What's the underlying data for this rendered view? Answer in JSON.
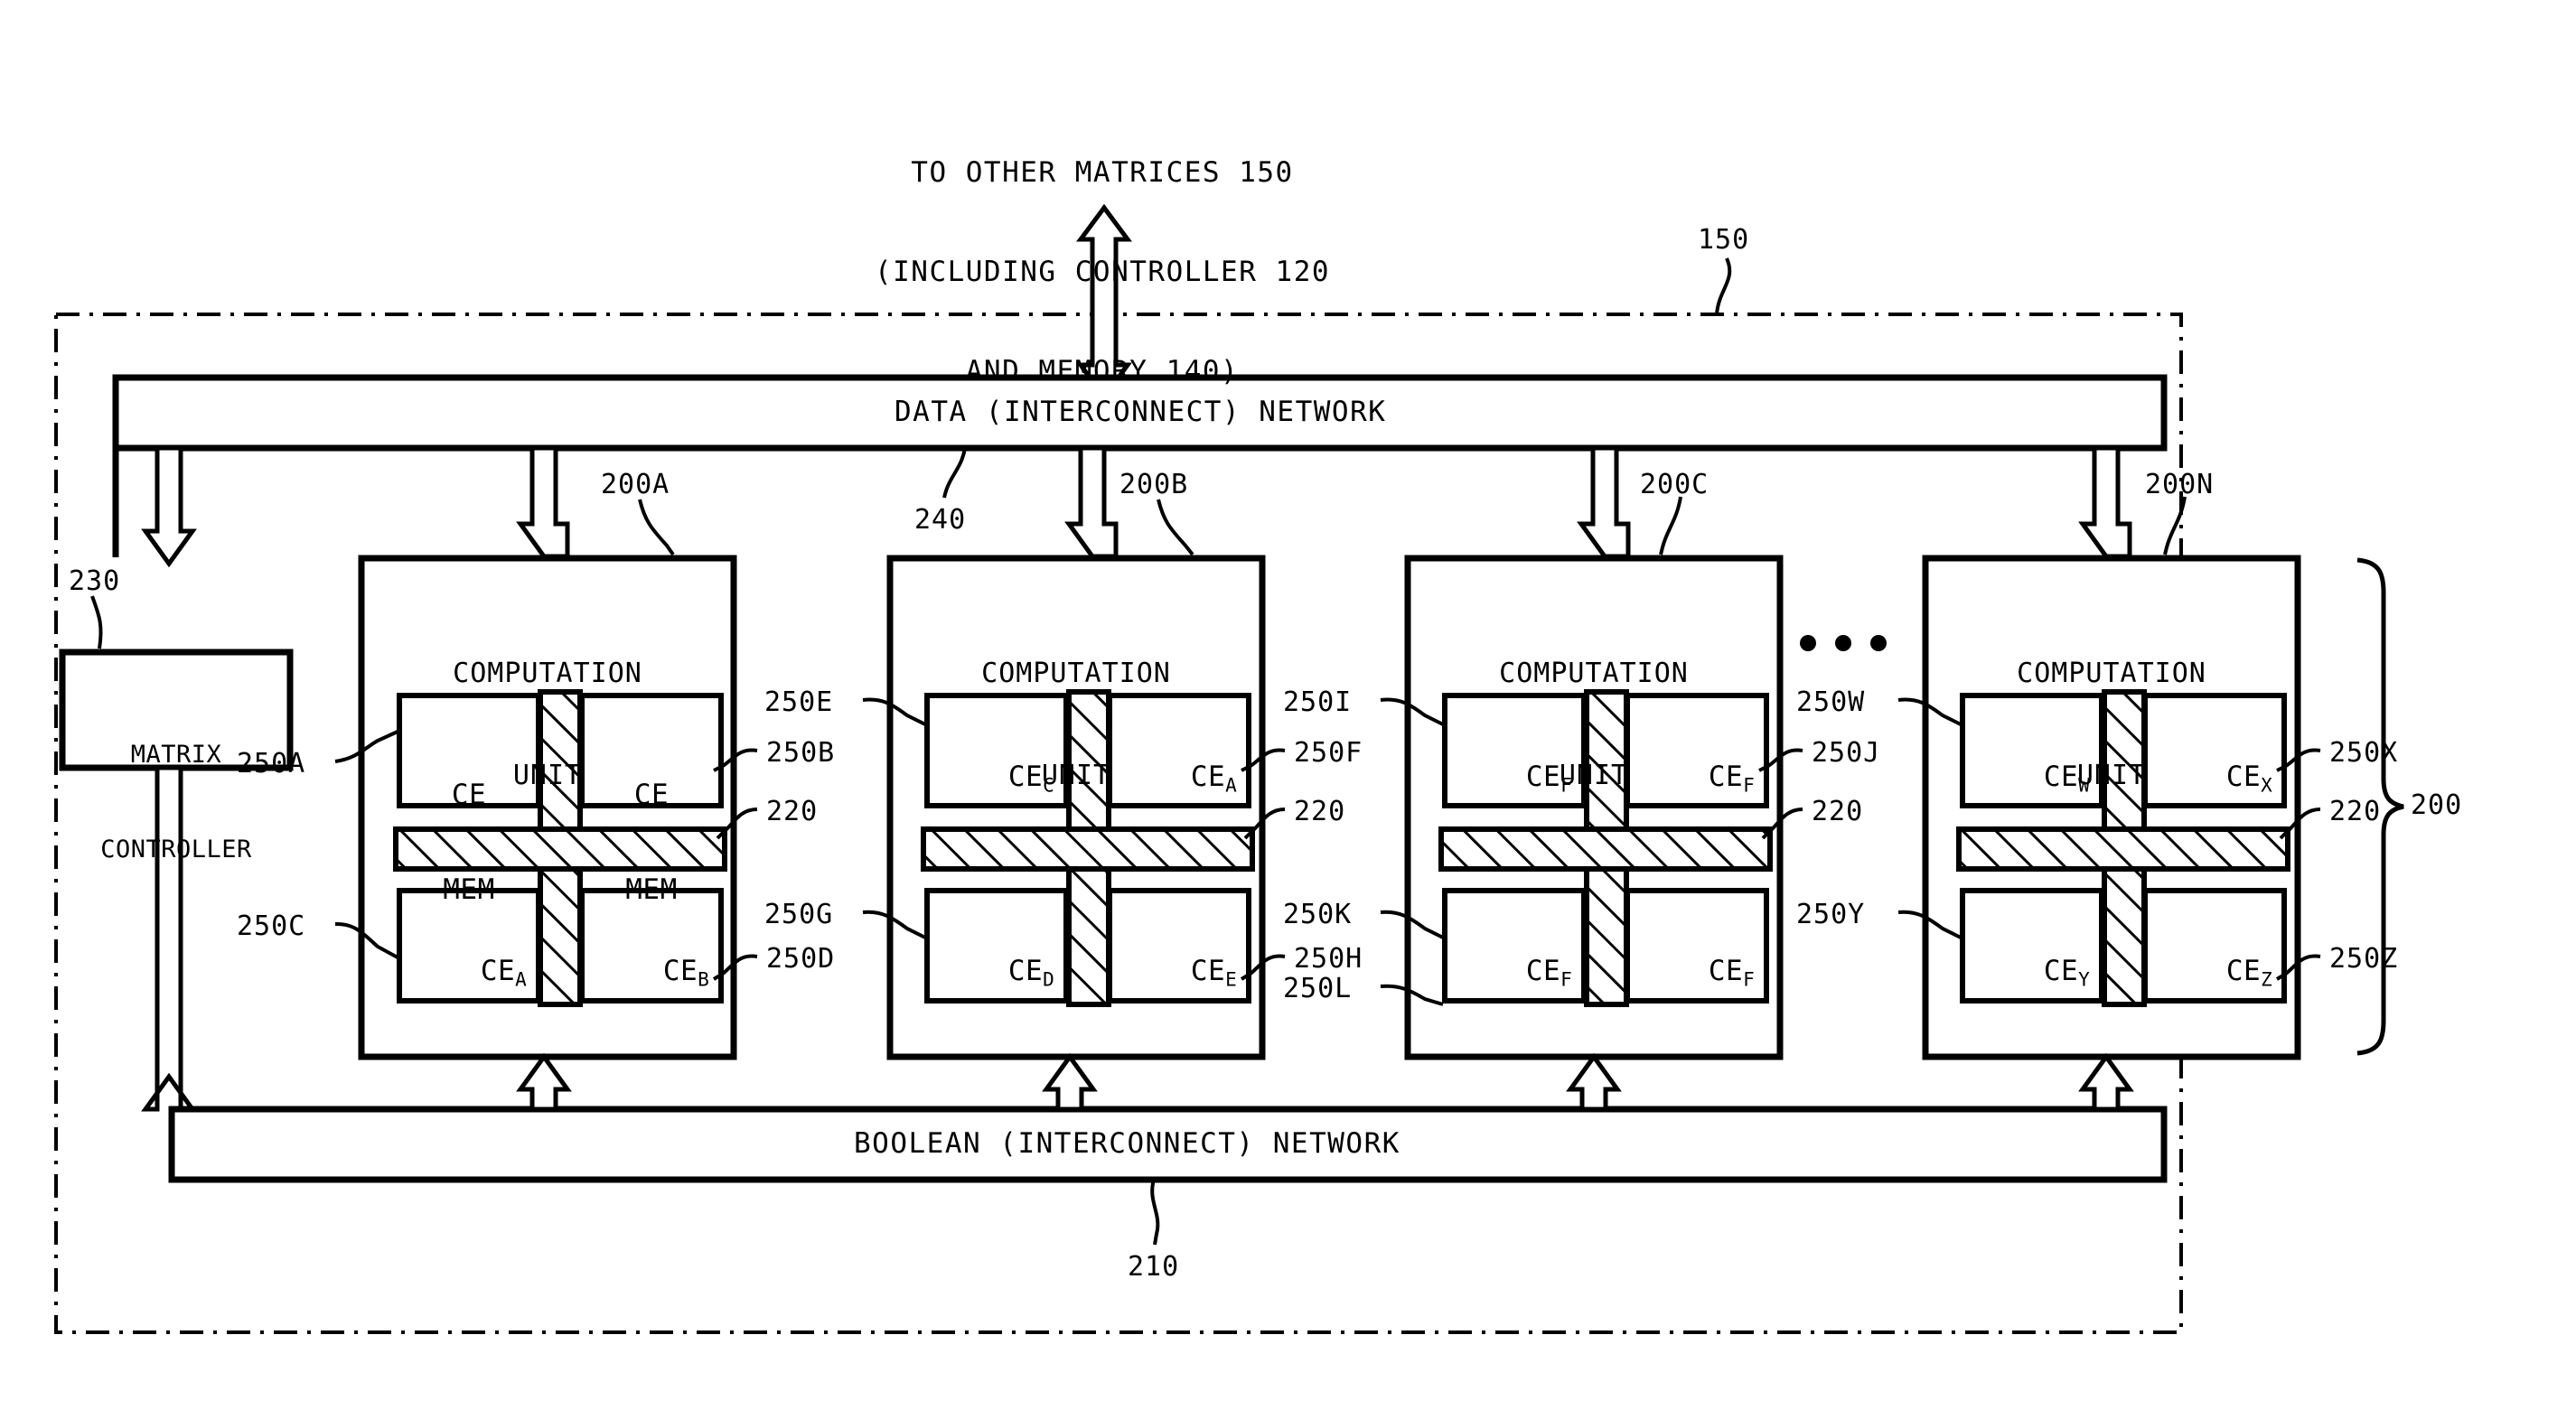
{
  "figure": {
    "header_note": "TO OTHER MATRICES 150\n(INCLUDING CONTROLLER 120\nAND MEMORY 140)",
    "header_line_1": "TO OTHER MATRICES 150",
    "header_line_2": "(INCLUDING CONTROLLER 120",
    "header_line_3": "AND MEMORY 140)",
    "outer_ref": "150",
    "group_brace_ref": "200"
  },
  "networks": {
    "data": {
      "label": "DATA (INTERCONNECT) NETWORK",
      "ref": "240"
    },
    "boolean": {
      "label": "BOOLEAN (INTERCONNECT) NETWORK",
      "ref": "210"
    }
  },
  "controller": {
    "line1": "MATRIX",
    "line2": "CONTROLLER",
    "ref": "230"
  },
  "units": [
    {
      "ref": "200A",
      "title_line1": "COMPUTATION",
      "title_line2": "UNIT",
      "interconnect_ref": "220",
      "cells": [
        {
          "prefix": "CE",
          "sub": "",
          "line2": "MEM",
          "ref": "250A",
          "ref_side": "left"
        },
        {
          "prefix": "CE",
          "sub": "",
          "line2": "MEM",
          "ref": "250B",
          "ref_side": "right"
        },
        {
          "prefix": "CE",
          "sub": "A",
          "line2": "",
          "ref": "250C",
          "ref_side": "left"
        },
        {
          "prefix": "CE",
          "sub": "B",
          "line2": "",
          "ref": "250D",
          "ref_side": "right"
        }
      ]
    },
    {
      "ref": "200B",
      "title_line1": "COMPUTATION",
      "title_line2": "UNIT",
      "interconnect_ref": "220",
      "cells": [
        {
          "prefix": "CE",
          "sub": "C",
          "line2": "",
          "ref": "250E",
          "ref_side": "left"
        },
        {
          "prefix": "CE",
          "sub": "A",
          "line2": "",
          "ref": "250F",
          "ref_side": "right"
        },
        {
          "prefix": "CE",
          "sub": "D",
          "line2": "",
          "ref": "250G",
          "ref_side": "left"
        },
        {
          "prefix": "CE",
          "sub": "E",
          "line2": "",
          "ref": "250H",
          "ref_side": "right"
        }
      ]
    },
    {
      "ref": "200C",
      "title_line1": "COMPUTATION",
      "title_line2": "UNIT",
      "interconnect_ref": "220",
      "cells": [
        {
          "prefix": "CE",
          "sub": "F",
          "line2": "",
          "ref": "250I",
          "ref_side": "left"
        },
        {
          "prefix": "CE",
          "sub": "F",
          "line2": "",
          "ref": "250J",
          "ref_side": "right"
        },
        {
          "prefix": "CE",
          "sub": "F",
          "line2": "",
          "ref": "250K",
          "ref_side": "left"
        },
        {
          "prefix": "CE",
          "sub": "F",
          "line2": "",
          "ref": "250L",
          "ref_side": "right"
        }
      ]
    },
    {
      "ref": "200N",
      "title_line1": "COMPUTATION",
      "title_line2": "UNIT",
      "interconnect_ref": "220",
      "cells": [
        {
          "prefix": "CE",
          "sub": "W",
          "line2": "",
          "ref": "250W",
          "ref_side": "left"
        },
        {
          "prefix": "CE",
          "sub": "X",
          "line2": "",
          "ref": "250X",
          "ref_side": "right"
        },
        {
          "prefix": "CE",
          "sub": "Y",
          "line2": "",
          "ref": "250Y",
          "ref_side": "left"
        },
        {
          "prefix": "CE",
          "sub": "Z",
          "line2": "",
          "ref": "250Z",
          "ref_side": "right"
        }
      ]
    }
  ],
  "ellipsis": "• • •",
  "colors": {
    "ink": "#000000",
    "paper": "#ffffff"
  }
}
